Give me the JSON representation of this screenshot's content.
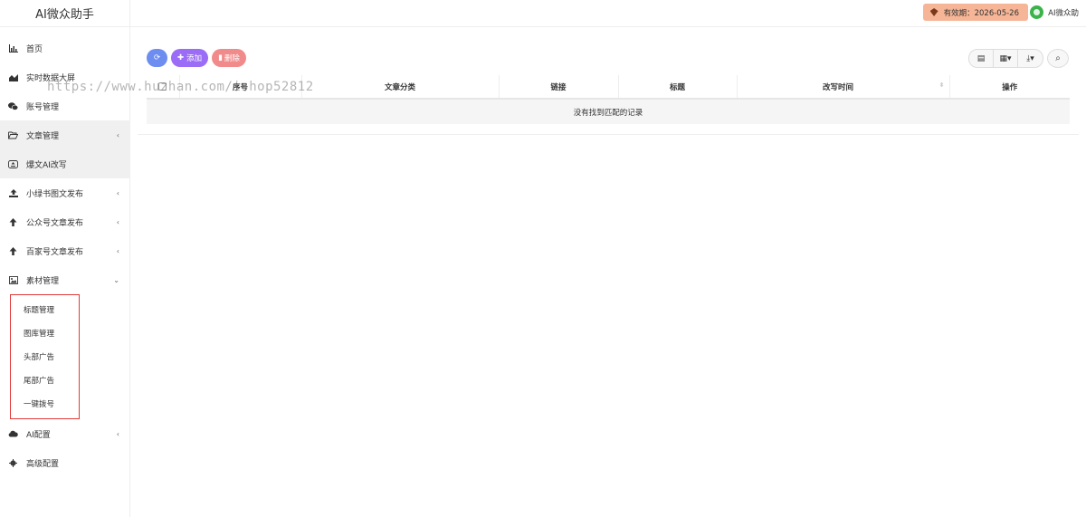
{
  "brand": "AI微众助手",
  "header": {
    "expiry_label": "有效期：2026-05-26",
    "user_name": "AI微众助"
  },
  "sidebar": {
    "items": [
      {
        "label": "首页",
        "icon": "bar-chart-icon"
      },
      {
        "label": "实时数据大屏",
        "icon": "area-chart-icon"
      },
      {
        "label": "账号管理",
        "icon": "wechat-icon"
      },
      {
        "label": "文章管理",
        "icon": "folder-open-icon"
      },
      {
        "label": "爆文AI改写",
        "icon": "upload-box-icon"
      },
      {
        "label": "小绿书图文发布",
        "icon": "upload-icon"
      },
      {
        "label": "公众号文章发布",
        "icon": "arrow-up-icon"
      },
      {
        "label": "百家号文章发布",
        "icon": "arrow-up-icon"
      },
      {
        "label": "素材管理",
        "icon": "image-icon"
      }
    ],
    "submenu": [
      "标题管理",
      "图库管理",
      "头部广告",
      "尾部广告",
      "一键拨号"
    ],
    "bottom_items": [
      {
        "label": "AI配置",
        "icon": "cloud-icon"
      },
      {
        "label": "高级配置",
        "icon": "gear-icon"
      }
    ]
  },
  "toolbar": {
    "add_label": "添加",
    "delete_label": "删除"
  },
  "table": {
    "columns": [
      "序号",
      "文章分类",
      "链接",
      "标题",
      "改写时间",
      "操作"
    ],
    "empty_text": "没有找到匹配的记录"
  },
  "watermark": "https://www.huzhan.com/ishop52812"
}
